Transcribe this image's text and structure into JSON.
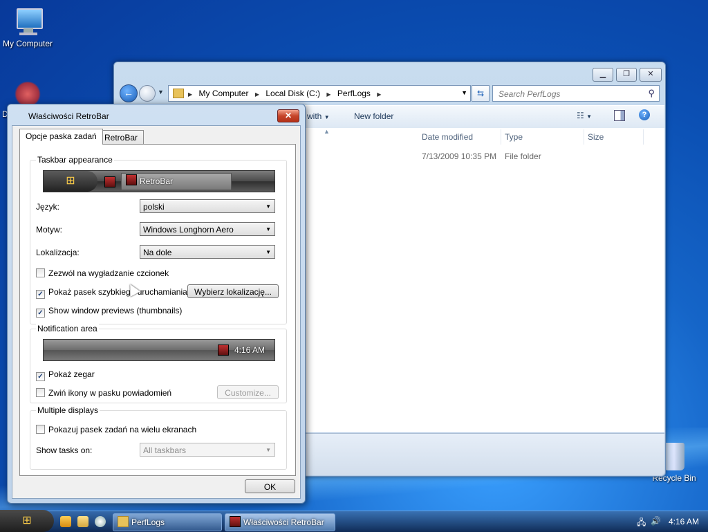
{
  "desktop": {
    "icons": [
      {
        "label": "My Computer"
      },
      {
        "label": "D"
      },
      {
        "label": "Recycle Bin"
      }
    ]
  },
  "explorer": {
    "address": [
      "My Computer",
      "Local Disk (C:)",
      "PerfLogs"
    ],
    "search_placeholder": "Search PerfLogs",
    "toolbar": {
      "share_with": "with",
      "new_folder": "New folder"
    },
    "columns": {
      "date": "Date modified",
      "type": "Type",
      "size": "Size"
    },
    "rows": [
      {
        "date": "7/13/2009 10:35 PM",
        "type": "File folder"
      }
    ]
  },
  "dialog": {
    "title": "Właściwości RetroBar",
    "tabs": [
      "Opcje paska zadań",
      "RetroBar"
    ],
    "appearance": {
      "title": "Taskbar appearance",
      "preview_task": "RetroBar",
      "language_label": "Język:",
      "language_value": "polski",
      "theme_label": "Motyw:",
      "theme_value": "Windows Longhorn Aero",
      "location_label": "Lokalizacja:",
      "location_value": "Na dole",
      "smooth_fonts": {
        "label": "Zezwól na wygładzanie czcionek",
        "checked": false
      },
      "quick_launch": {
        "label": "Pokaż pasek szybkiego uruchamiania",
        "checked": true
      },
      "choose_location": "Wybierz lokalizację...",
      "previews": {
        "label": "Show window previews (thumbnails)",
        "checked": true
      }
    },
    "notification": {
      "title": "Notification area",
      "clock_time": "4:16 AM",
      "show_clock": {
        "label": "Pokaż zegar",
        "checked": true
      },
      "collapse_icons": {
        "label": "Zwiń ikony w pasku powiadomień",
        "checked": false
      },
      "customize": "Customize..."
    },
    "multi": {
      "title": "Multiple displays",
      "show_all": {
        "label": "Pokazuj pasek zadań na wielu ekranach",
        "checked": false
      },
      "show_tasks_label": "Show tasks on:",
      "show_tasks_value": "All taskbars"
    },
    "ok": "OK"
  },
  "taskbar": {
    "buttons": [
      "PerfLogs",
      "Właściwości RetroBar"
    ],
    "clock": "4:16 AM"
  },
  "colors": {
    "desktop_blue": "#0b4fb3",
    "close_red": "#c6452a"
  }
}
